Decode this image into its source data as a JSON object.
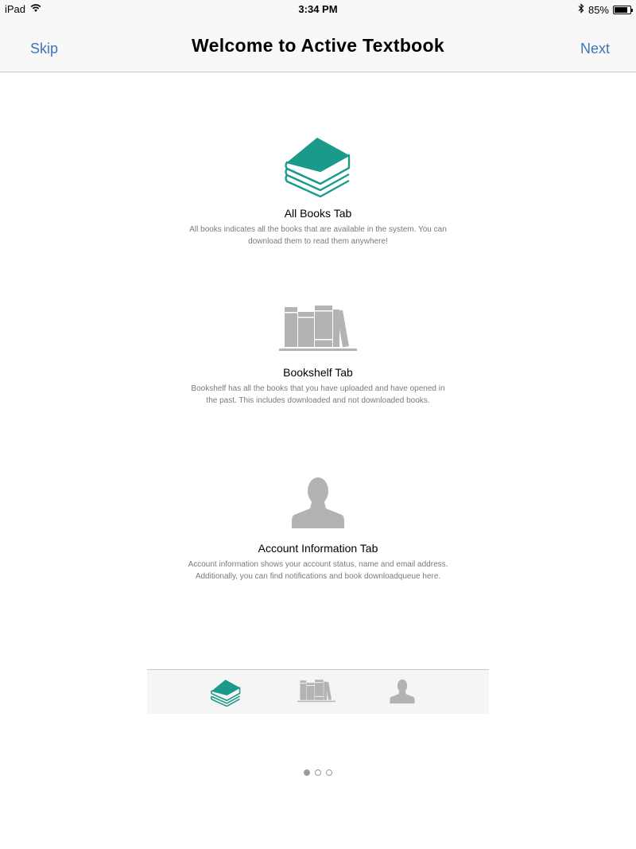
{
  "status_bar": {
    "device": "iPad",
    "time": "3:34 PM",
    "battery_percent": "85%",
    "battery_level": 0.85
  },
  "nav": {
    "left_label": "Skip",
    "title": "Welcome to Active Textbook",
    "right_label": "Next"
  },
  "sections": [
    {
      "icon": "books-stack-icon",
      "title": "All Books Tab",
      "description": "All books indicates all the books that are available in the system. You can download them to read them anywhere!"
    },
    {
      "icon": "bookshelf-icon",
      "title": "Bookshelf Tab",
      "description": "Bookshelf has all the books that you have uploaded and have opened in the past. This includes downloaded and not downloaded books."
    },
    {
      "icon": "person-icon",
      "title": "Account Information Tab",
      "description": "Account information shows your account status, name and email address. Additionally, you can find notifications and book downloadqueue here."
    }
  ],
  "tab_bar": {
    "items": [
      "books-stack-icon",
      "bookshelf-icon",
      "person-icon"
    ],
    "selected_index": 0
  },
  "page_indicator": {
    "total": 3,
    "current": 1
  },
  "colors": {
    "accent_teal": "#1a9b8a",
    "icon_gray": "#b3b3b3",
    "link_blue": "#3b76b7"
  }
}
